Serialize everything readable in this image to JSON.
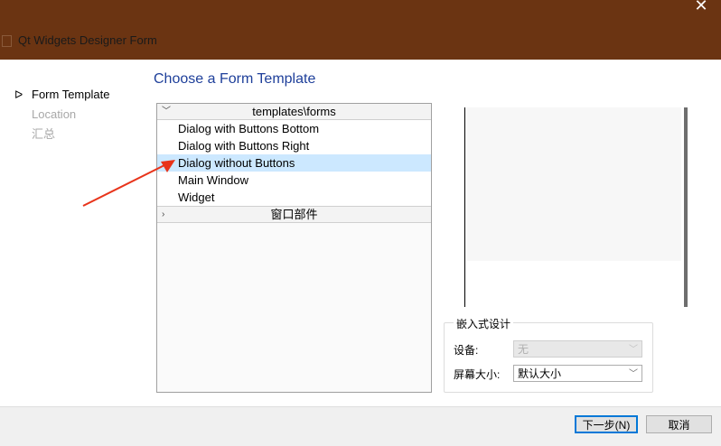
{
  "window": {
    "title": "Qt Widgets Designer Form",
    "close_glyph": "✕",
    "icon": "app-icon"
  },
  "wizard_nav": [
    {
      "label": "Form Template",
      "active": true,
      "marker": "ᐅ"
    },
    {
      "label": "Location",
      "active": false
    },
    {
      "label": "汇总",
      "active": false
    }
  ],
  "page_title": "Choose a Form Template",
  "tree": {
    "groups": [
      {
        "header": "templates\\forms",
        "expanded": true,
        "chevron": "﹀",
        "items": [
          "Dialog with Buttons Bottom",
          "Dialog with Buttons Right",
          "Dialog without Buttons",
          "Main Window",
          "Widget"
        ],
        "selected": "Dialog without Buttons"
      },
      {
        "header": "窗口部件",
        "expanded": false,
        "chevron": "›"
      }
    ]
  },
  "annotation": {
    "color": "#e8331a"
  },
  "embedded": {
    "title": "嵌入式设计",
    "device_label": "设备:",
    "device_value": "无",
    "screen_label": "屏幕大小:",
    "screen_value": "默认大小",
    "chevron": "﹀"
  },
  "buttons": {
    "next": "下一步(N)",
    "cancel": "取消"
  },
  "colors": {
    "titlebar": "#6b3412",
    "title_text": "#1e3f9a",
    "selection": "#cce8ff",
    "primary_border": "#0078d7"
  }
}
